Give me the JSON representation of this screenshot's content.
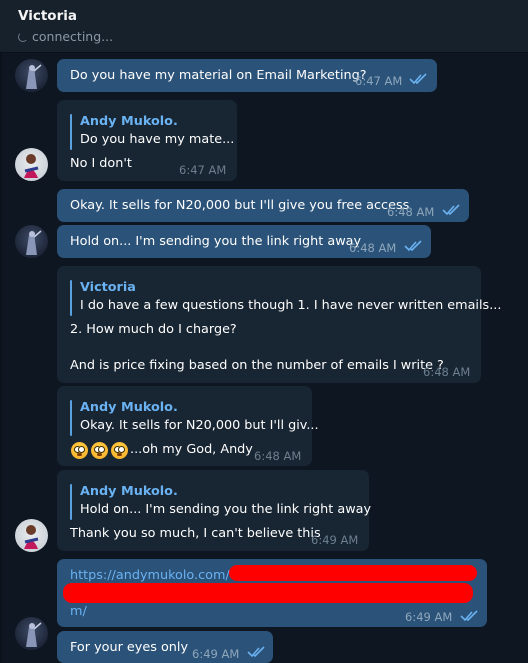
{
  "header": {
    "title": "Victoria",
    "status": "connecting..."
  },
  "messages": [
    {
      "id": "m1",
      "direction": "out",
      "text": "Do you have my material on Email Marketing?",
      "time": "6:47 AM",
      "read": true
    },
    {
      "id": "m2",
      "direction": "in",
      "reply": {
        "name": "Andy Mukolo.",
        "text": "Do you have my mate..."
      },
      "text": "No I don't",
      "time": "6:47 AM"
    },
    {
      "id": "m3",
      "direction": "out",
      "text": "Okay. It sells for N20,000 but I'll give you free access",
      "time": "6:48 AM",
      "read": true
    },
    {
      "id": "m4",
      "direction": "out",
      "text": "Hold on... I'm sending you the link right away",
      "time": "6:48 AM",
      "read": true
    },
    {
      "id": "m5",
      "direction": "in",
      "reply": {
        "name": "Victoria",
        "text": "I do have a few questions though  1. I have never written emails..."
      },
      "lines": [
        "2. How much do I charge?",
        "",
        "And is price fixing based on the number of emails I write ?"
      ],
      "time": "6:48 AM"
    },
    {
      "id": "m6",
      "direction": "in",
      "reply": {
        "name": "Andy Mukolo.",
        "text": "Okay. It sells for N20,000 but I'll giv..."
      },
      "emojis": [
        "flushed-face",
        "flushed-face",
        "flushed-face"
      ],
      "text": "...oh my God, Andy",
      "time": "6:48 AM"
    },
    {
      "id": "m7",
      "direction": "in",
      "reply": {
        "name": "Andy Mukolo.",
        "text": "Hold on... I'm sending you the link right away"
      },
      "text": "Thank you so much, I can't believe this",
      "time": "6:49 AM"
    },
    {
      "id": "m8",
      "direction": "out",
      "link_start": "https://andymukolo.com/",
      "link_end": "m/",
      "redacted": true,
      "time": "6:49 AM",
      "read": true
    },
    {
      "id": "m9",
      "direction": "out",
      "text": "For your eyes only",
      "time": "6:49 AM",
      "read": true
    }
  ],
  "colors": {
    "background": "#0e1621",
    "header": "#17212b",
    "outgoing_bubble": "#2b5278",
    "incoming_bubble": "#182533",
    "accent": "#6ab2f2",
    "redaction": "#ff0000"
  }
}
